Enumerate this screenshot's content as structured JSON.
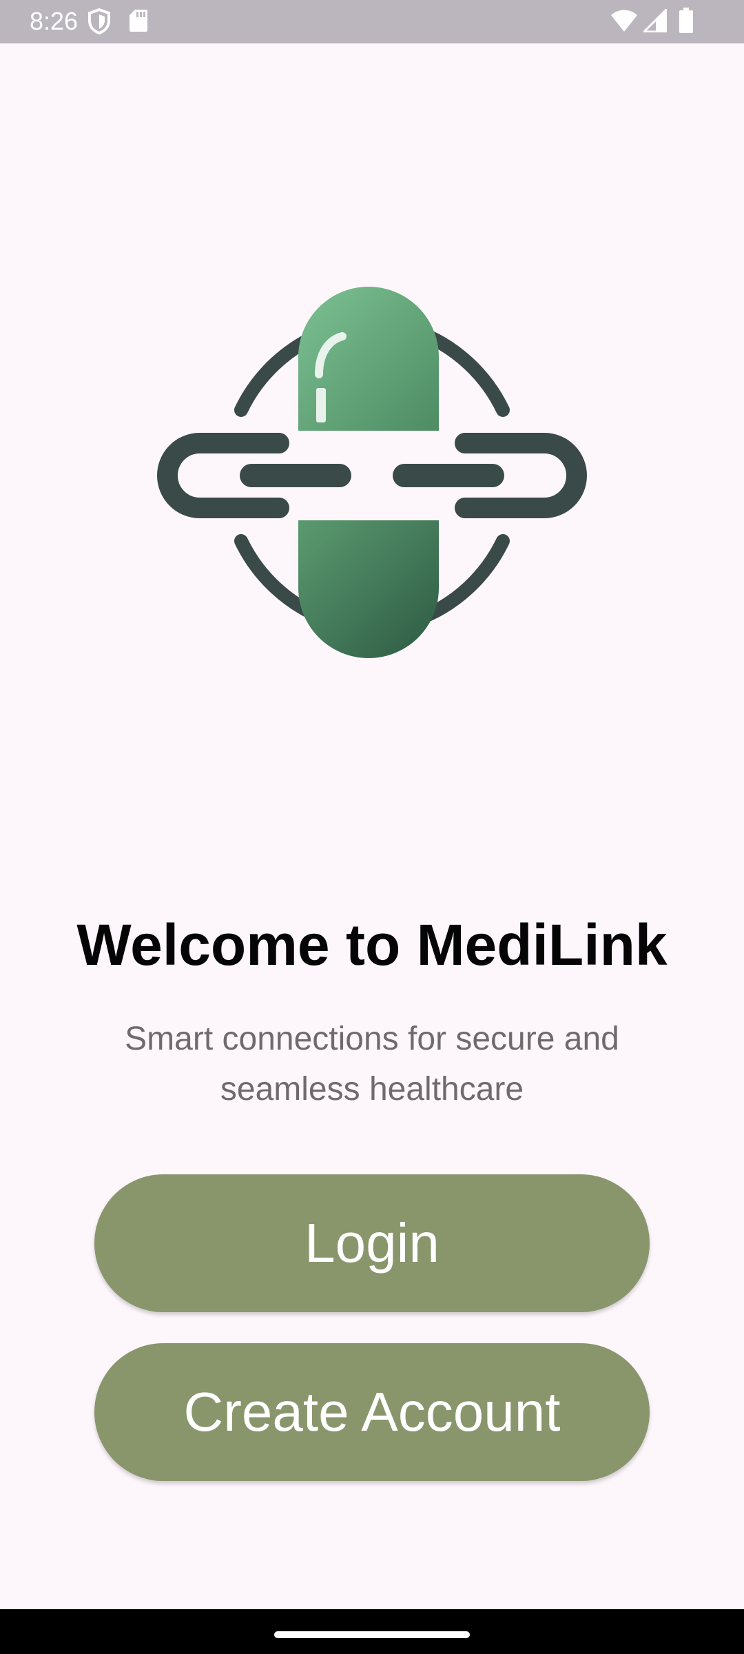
{
  "status_bar": {
    "time": "8:26",
    "left_icons": [
      "shield-icon",
      "sd-card-icon"
    ],
    "right_icons": [
      "wifi-icon",
      "cellular-signal-icon",
      "battery-icon"
    ]
  },
  "logo": {
    "icon": "pill-chain-globe-logo",
    "colors": {
      "pill_green": "#5a9c72",
      "dark_slate": "#3a4a48"
    }
  },
  "welcome": {
    "title": "Welcome to MediLink",
    "subtitle_line1": "Smart connections for secure and",
    "subtitle_line2": "seamless healthcare"
  },
  "actions": {
    "login_label": "Login",
    "create_account_label": "Create Account"
  },
  "colors": {
    "background": "#fdf7fc",
    "button": "#89966c",
    "status_bar": "#bbb6bd",
    "title": "#050505",
    "subtitle": "#6f6a6f"
  }
}
